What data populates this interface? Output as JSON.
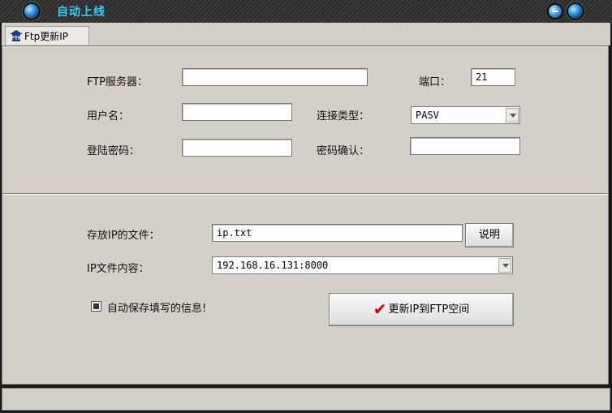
{
  "window": {
    "title": "自动上线"
  },
  "tabs": [
    {
      "label": "Ftp更新IP",
      "icon": "ftp-icon"
    }
  ],
  "ftp": {
    "server_label": "FTP服务器：",
    "server_value": "",
    "port_label": "端口：",
    "port_value": "21",
    "user_label": "用户名：",
    "user_value": "",
    "conn_type_label": "连接类型：",
    "conn_type_value": "PASV",
    "password_label": "登陆密码：",
    "password_value": "",
    "confirm_label": "密码确认：",
    "confirm_value": ""
  },
  "file": {
    "file_label": "存放IP的文件：",
    "file_value": "ip.txt",
    "explain_button": "说明",
    "content_label": "IP文件内容：",
    "content_value": "192.168.16.131:8000"
  },
  "options": {
    "autosave_label": "自动保存填写的信息!",
    "autosave_checked": true
  },
  "actions": {
    "update_button": "更新IP到FTP空间"
  },
  "colors": {
    "title_text": "#33ccff",
    "check_mark": "#d10000",
    "panel_bg": "#d4d0c8"
  }
}
